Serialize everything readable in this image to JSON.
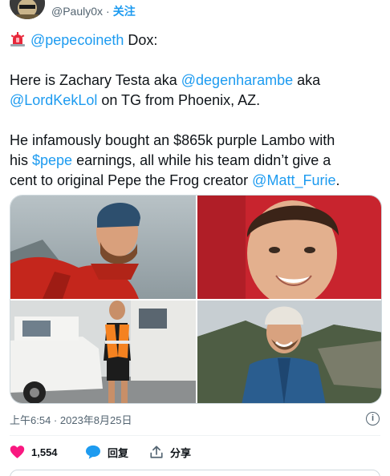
{
  "author": {
    "handle": "@Pauly0x",
    "separator": "·",
    "follow_label": "关注"
  },
  "tweet": {
    "emoji": "siren-icon",
    "line1_mention": "@pepecoineth",
    "line1_text": " Dox:",
    "line2_pre": "Here is Zachary Testa aka ",
    "line2_mention": "@degenharambe",
    "line2_post": " aka",
    "line3_mention": "@LordKekLol",
    "line3_post": " on TG from Phoenix, AZ.",
    "line4": "He infamously bought an $865k purple Lambo with",
    "line5_pre": "his ",
    "line5_cashtag": "$pepe",
    "line5_post": " earnings, all while his team didn’t give a",
    "line6_pre": "cent to original Pepe the Frog creator ",
    "line6_mention": "@Matt_Furie",
    "line6_post": "."
  },
  "meta": {
    "time": "上午6:54",
    "separator": " · ",
    "date": "2023年8月25日"
  },
  "actions": {
    "like_count": "1,554",
    "reply_label": "回复",
    "share_label": "分享"
  },
  "colors": {
    "accent": "#1d9bf0",
    "like": "#f91880",
    "text": "#0f1419",
    "secondary": "#536471"
  }
}
